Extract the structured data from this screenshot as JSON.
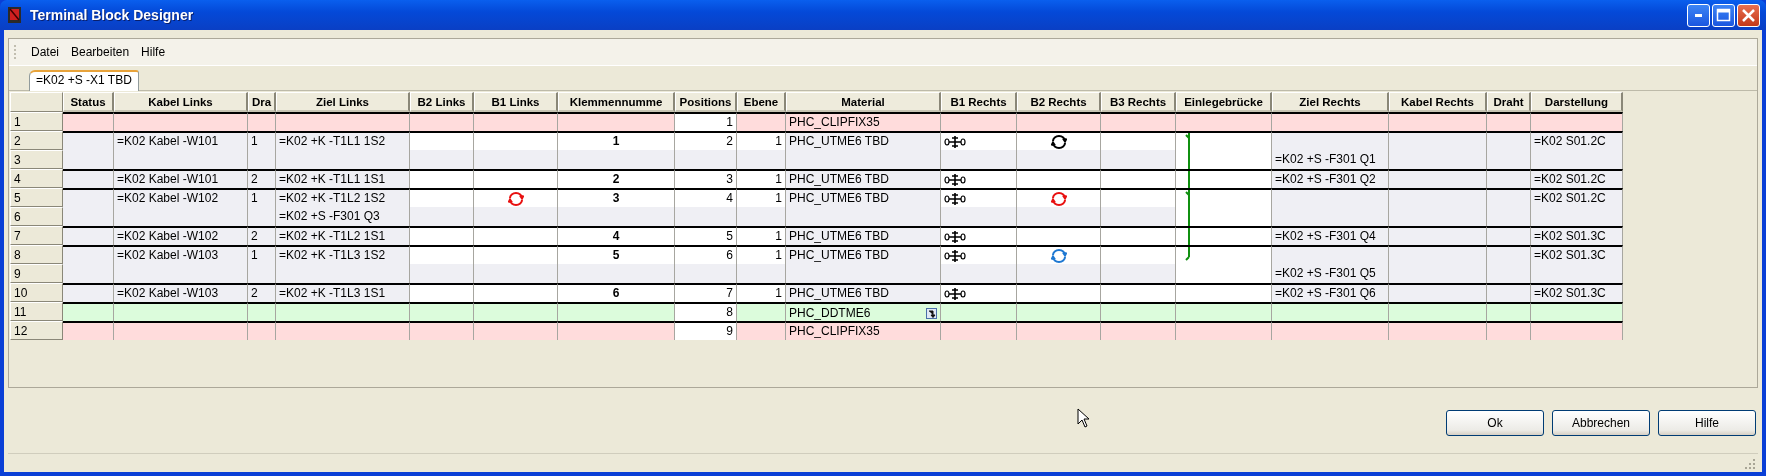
{
  "window": {
    "title": "Terminal Block Designer"
  },
  "menu": [
    "Datei",
    "Bearbeiten",
    "Hilfe"
  ],
  "tabs": [
    {
      "label": "=K02 +S -X1 TBD",
      "selected": true
    }
  ],
  "table": {
    "columns": [
      "Status",
      "Kabel Links",
      "Dra",
      "Ziel Links",
      "B2 Links",
      "B1 Links",
      "Klemmennumme",
      "Positions",
      "Ebene",
      "Material",
      "B1 Rechts",
      "B2 Rechts",
      "B3 Rechts",
      "Einlegebrücke",
      "Ziel Rechts",
      "Kabel Rechts",
      "Draht",
      "Darstellung"
    ],
    "rows": [
      {
        "number": "1",
        "kind": "clip",
        "cells": [
          null,
          null,
          null,
          null,
          null,
          null,
          null,
          "1",
          null,
          "PHC_CLIPFIX35",
          null,
          null,
          null,
          null,
          null,
          null,
          null,
          null
        ]
      },
      {
        "number": "2",
        "kind": "terminal",
        "cells": [
          null,
          "=K02 Kabel -W101",
          "1",
          "=K02 +K -T1L1 1S2",
          null,
          null,
          "1",
          "2",
          "1",
          "PHC_UTME6 TBD",
          {
            "kind": "jumper"
          },
          {
            "kind": "ring",
            "color": "#000000"
          },
          null,
          {
            "kind": "bridge",
            "hook": true,
            "below": true
          },
          null,
          null,
          null,
          "=K02 S01.2C"
        ]
      },
      {
        "number": "3",
        "kind": "continuation",
        "cells": [
          null,
          null,
          null,
          null,
          null,
          null,
          null,
          null,
          null,
          null,
          null,
          null,
          null,
          {
            "kind": "bridge",
            "hook": false,
            "below": true
          },
          "=K02 +S -F301 Q1",
          null,
          null,
          null
        ]
      },
      {
        "number": "4",
        "kind": "terminal",
        "cells": [
          null,
          "=K02 Kabel -W101",
          "2",
          "=K02 +K -T1L1 1S1",
          null,
          null,
          "2",
          "3",
          "1",
          "PHC_UTME6 TBD",
          {
            "kind": "jumper"
          },
          null,
          null,
          {
            "kind": "bridge",
            "hook": false,
            "below": true
          },
          "=K02 +S -F301 Q2",
          null,
          null,
          "=K02 S01.2C"
        ]
      },
      {
        "number": "5",
        "kind": "terminal",
        "cells": [
          null,
          "=K02 Kabel -W102",
          "1",
          "=K02 +K -T1L2 1S2",
          null,
          {
            "kind": "ring",
            "color": "#e81010"
          },
          "3",
          "4",
          "1",
          "PHC_UTME6 TBD",
          {
            "kind": "jumper"
          },
          {
            "kind": "ring",
            "color": "#e81010"
          },
          null,
          {
            "kind": "bridge",
            "hook": true,
            "below": true
          },
          null,
          null,
          null,
          "=K02 S01.2C"
        ]
      },
      {
        "number": "6",
        "kind": "continuation",
        "cells": [
          null,
          null,
          null,
          "=K02 +S -F301 Q3",
          null,
          null,
          null,
          null,
          null,
          null,
          null,
          null,
          null,
          {
            "kind": "bridge",
            "hook": false,
            "below": true
          },
          null,
          null,
          null,
          null
        ]
      },
      {
        "number": "7",
        "kind": "terminal",
        "cells": [
          null,
          "=K02 Kabel -W102",
          "2",
          "=K02 +K -T1L2 1S1",
          null,
          null,
          "4",
          "5",
          "1",
          "PHC_UTME6 TBD",
          {
            "kind": "jumper"
          },
          null,
          null,
          {
            "kind": "bridge",
            "hook": false,
            "below": true
          },
          "=K02 +S -F301 Q4",
          null,
          null,
          "=K02 S01.3C"
        ]
      },
      {
        "number": "8",
        "kind": "terminal",
        "cells": [
          null,
          "=K02 Kabel -W103",
          "1",
          "=K02 +K -T1L3 1S2",
          null,
          null,
          "5",
          "6",
          "1",
          "PHC_UTME6 TBD",
          {
            "kind": "jumper"
          },
          {
            "kind": "ring",
            "color": "#1e78d2"
          },
          null,
          {
            "kind": "bridge",
            "hook": true,
            "below": false
          },
          null,
          null,
          null,
          "=K02 S01.3C"
        ]
      },
      {
        "number": "9",
        "kind": "continuation",
        "cells": [
          null,
          null,
          null,
          null,
          null,
          null,
          null,
          null,
          null,
          null,
          null,
          null,
          null,
          null,
          "=K02 +S -F301 Q5",
          null,
          null,
          null
        ]
      },
      {
        "number": "10",
        "kind": "terminal",
        "cells": [
          null,
          "=K02 Kabel -W103",
          "2",
          "=K02 +K -T1L3 1S1",
          null,
          null,
          "6",
          "7",
          "1",
          "PHC_UTME6 TBD",
          {
            "kind": "jumper"
          },
          null,
          null,
          null,
          "=K02 +S -F301 Q6",
          null,
          null,
          "=K02 S01.3C"
        ]
      },
      {
        "number": "11",
        "kind": "accessory",
        "cells": [
          null,
          null,
          null,
          null,
          null,
          null,
          null,
          "8",
          null,
          {
            "kind": "text_with_button",
            "text": "PHC_DDTME6"
          },
          null,
          null,
          null,
          null,
          null,
          null,
          null,
          null
        ]
      },
      {
        "number": "12",
        "kind": "clip",
        "cells": [
          null,
          null,
          null,
          null,
          null,
          null,
          null,
          "9",
          null,
          "PHC_CLIPFIX35",
          null,
          null,
          null,
          null,
          null,
          null,
          null,
          null
        ]
      }
    ]
  },
  "buttons": [
    "Ok",
    "Abbrechen",
    "Hilfe"
  ]
}
